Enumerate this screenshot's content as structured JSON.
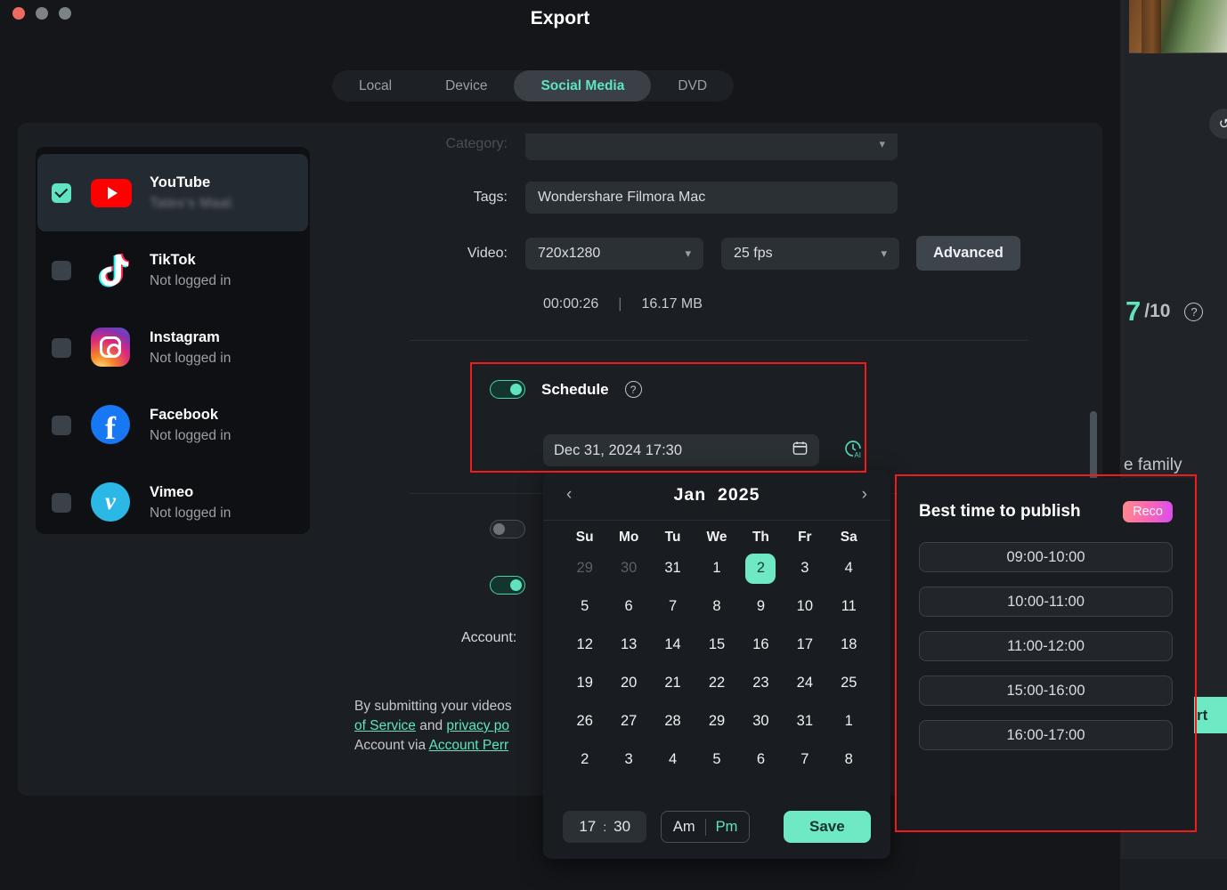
{
  "window": {
    "title": "Export",
    "traffic_lights": [
      "close",
      "minimize",
      "maximize"
    ]
  },
  "tabs": [
    {
      "label": "Local",
      "active": false
    },
    {
      "label": "Device",
      "active": false
    },
    {
      "label": "Social Media",
      "active": true
    },
    {
      "label": "DVD",
      "active": false
    }
  ],
  "sidebar": {
    "accounts": [
      {
        "name": "YouTube",
        "status": "Tatex’s Maal.",
        "status_blurred": true,
        "checked": true,
        "selected": true,
        "icon": "youtube-icon"
      },
      {
        "name": "TikTok",
        "status": "Not logged in",
        "status_blurred": false,
        "checked": false,
        "selected": false,
        "icon": "tiktok-icon"
      },
      {
        "name": "Instagram",
        "status": "Not logged in",
        "status_blurred": false,
        "checked": false,
        "selected": false,
        "icon": "instagram-icon"
      },
      {
        "name": "Facebook",
        "status": "Not logged in",
        "status_blurred": false,
        "checked": false,
        "selected": false,
        "icon": "facebook-icon"
      },
      {
        "name": "Vimeo",
        "status": "Not logged in",
        "status_blurred": false,
        "checked": false,
        "selected": false,
        "icon": "vimeo-icon"
      }
    ]
  },
  "form": {
    "category_label": "Category:",
    "tags_label": "Tags:",
    "tags_value": "Wondershare Filmora Mac",
    "video_label": "Video:",
    "resolution_value": "720x1280",
    "fps_value": "25 fps",
    "advanced_label": "Advanced",
    "duration": "00:00:26",
    "separator": "|",
    "filesize": "16.17 MB",
    "schedule_label": "Schedule",
    "schedule_toggle_on": true,
    "schedule_value": "Dec 31, 2024  17:30",
    "calendar_icon": "calendar-icon",
    "ai_time_icon": "ai-clock-icon",
    "toggle_two_on": false,
    "toggle_three_on": true,
    "account_label": "Account:"
  },
  "terms": {
    "line1": "By submitting your videos",
    "link1": "of Service",
    "mid1": " and ",
    "link2": "privacy po",
    "line3_pre": "Account via ",
    "link3": "Account Perr"
  },
  "calendar": {
    "prev_icon": "chevron-left-icon",
    "next_icon": "chevron-right-icon",
    "month": "Jan",
    "year": "2025",
    "weekdays": [
      "Su",
      "Mo",
      "Tu",
      "We",
      "Th",
      "Fr",
      "Sa"
    ],
    "weeks": [
      [
        {
          "d": "29",
          "mute": true
        },
        {
          "d": "30",
          "mute": true
        },
        {
          "d": "31",
          "mute": false
        },
        {
          "d": "1",
          "mute": false
        },
        {
          "d": "2",
          "mute": false,
          "selected": true
        },
        {
          "d": "3",
          "mute": false
        },
        {
          "d": "4",
          "mute": false
        }
      ],
      [
        {
          "d": "5",
          "mute": false
        },
        {
          "d": "6",
          "mute": false
        },
        {
          "d": "7",
          "mute": false
        },
        {
          "d": "8",
          "mute": false
        },
        {
          "d": "9",
          "mute": false
        },
        {
          "d": "10",
          "mute": false
        },
        {
          "d": "11",
          "mute": false
        }
      ],
      [
        {
          "d": "12",
          "mute": false
        },
        {
          "d": "13",
          "mute": false
        },
        {
          "d": "14",
          "mute": false
        },
        {
          "d": "15",
          "mute": false
        },
        {
          "d": "16",
          "mute": false
        },
        {
          "d": "17",
          "mute": false
        },
        {
          "d": "18",
          "mute": false
        }
      ],
      [
        {
          "d": "19",
          "mute": false
        },
        {
          "d": "20",
          "mute": false
        },
        {
          "d": "21",
          "mute": false
        },
        {
          "d": "22",
          "mute": false
        },
        {
          "d": "23",
          "mute": false
        },
        {
          "d": "24",
          "mute": false
        },
        {
          "d": "25",
          "mute": false
        }
      ],
      [
        {
          "d": "26",
          "mute": false
        },
        {
          "d": "27",
          "mute": false
        },
        {
          "d": "28",
          "mute": false
        },
        {
          "d": "29",
          "mute": false
        },
        {
          "d": "30",
          "mute": false
        },
        {
          "d": "31",
          "mute": false
        },
        {
          "d": "1",
          "mute": false
        }
      ],
      [
        {
          "d": "2",
          "mute": false
        },
        {
          "d": "3",
          "mute": false
        },
        {
          "d": "4",
          "mute": false
        },
        {
          "d": "5",
          "mute": false
        },
        {
          "d": "6",
          "mute": false
        },
        {
          "d": "7",
          "mute": false
        },
        {
          "d": "8",
          "mute": false
        }
      ]
    ],
    "hour": "17",
    "colon": ":",
    "minute": "30",
    "am_label": "Am",
    "pm_label": "Pm",
    "meridiem_selected": "Pm",
    "save_label": "Save"
  },
  "best_time": {
    "title": "Best time to publish",
    "badge": "Reco",
    "slots": [
      "09:00-10:00",
      "10:00-11:00",
      "11:00-12:00",
      "15:00-16:00",
      "16:00-17:00"
    ]
  },
  "background": {
    "score_value": "7",
    "score_denom": "/10",
    "caption_fragment": "e family",
    "export_fragment": "rt"
  },
  "colors": {
    "accent_teal": "#5fe3c0",
    "highlight_red": "#f31a1a",
    "panel_bg": "#1b1e22",
    "window_bg": "#141619",
    "input_bg": "#2b3035",
    "badge_pink": "#ff6ab0"
  }
}
